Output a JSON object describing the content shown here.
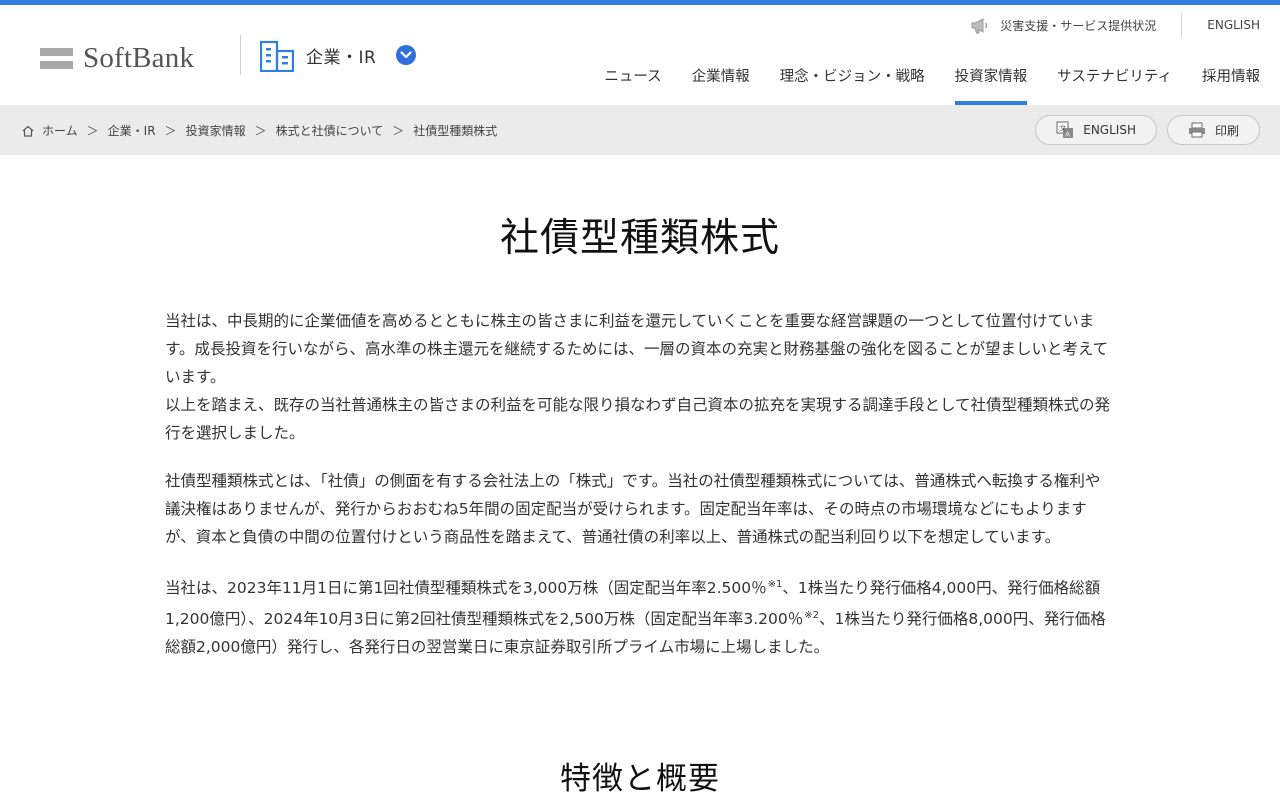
{
  "colors": {
    "accent": "#2f7fe0",
    "chevron": "#2f6fdc",
    "crumb_bg": "#ebebeb"
  },
  "header": {
    "logo_text": "SoftBank",
    "section_label": "企業・IR",
    "util": {
      "disaster_label": "災害支援・サービス提供状況",
      "english_label": "ENGLISH"
    },
    "nav": [
      {
        "label": "ニュース"
      },
      {
        "label": "企業情報"
      },
      {
        "label": "理念・ビジョン・戦略"
      },
      {
        "label": "投資家情報",
        "active": true
      },
      {
        "label": "サステナビリティ"
      },
      {
        "label": "採用情報"
      }
    ]
  },
  "breadcrumb": {
    "items": [
      "ホーム",
      "企業・IR",
      "投資家情報",
      "株式と社債について",
      "社債型種類株式"
    ],
    "separator": "＞",
    "english_button": "ENGLISH",
    "print_button": "印刷"
  },
  "main": {
    "title": "社債型種類株式",
    "para1_line1": "当社は、中長期的に企業価値を高めるとともに株主の皆さまに利益を還元していくことを重要な経営課題の一つとして位置付けています。成長投資を行いながら、高水準の株主還元を継続するためには、一層の資本の充実と財務基盤の強化を図ることが望ましいと考えています。",
    "para1_line2": "以上を踏まえ、既存の当社普通株主の皆さまの利益を可能な限り損なわず自己資本の拡充を実現する調達手段として社債型種類株式の発行を選択しました。",
    "para2": "社債型種類株式とは、「社債」の側面を有する会社法上の「株式」です。当社の社債型種類株式については、普通株式へ転換する権利や議決権はありませんが、発行からおおむね5年間の固定配当が受けられます。固定配当年率は、その時点の市場環境などにもよりますが、資本と負債の中間の位置付けという商品性を踏まえて、普通社債の利率以上、普通株式の配当利回り以下を想定しています。",
    "para3_a": "当社は、2023年11月1日に第1回社債型種類株式を3,000万株（固定配当年率2.500％",
    "para3_note1": "※1",
    "para3_b": "、1株当たり発行価格4,000円、発行価格総額1,200億円）、2024年10月3日に第2回社債型種類株式を2,500万株（固定配当年率3.200％",
    "para3_note2": "※2",
    "para3_c": "、1株当たり発行価格8,000円、発行価格総額2,000億円）発行し、各発行日の翌営業日に東京証券取引所プライム市場に上場しました。",
    "section_heading": "特徴と概要"
  },
  "icons": [
    "megaphone-icon",
    "building-icon",
    "chevron-down-icon",
    "home-icon",
    "translate-icon",
    "printer-icon"
  ]
}
